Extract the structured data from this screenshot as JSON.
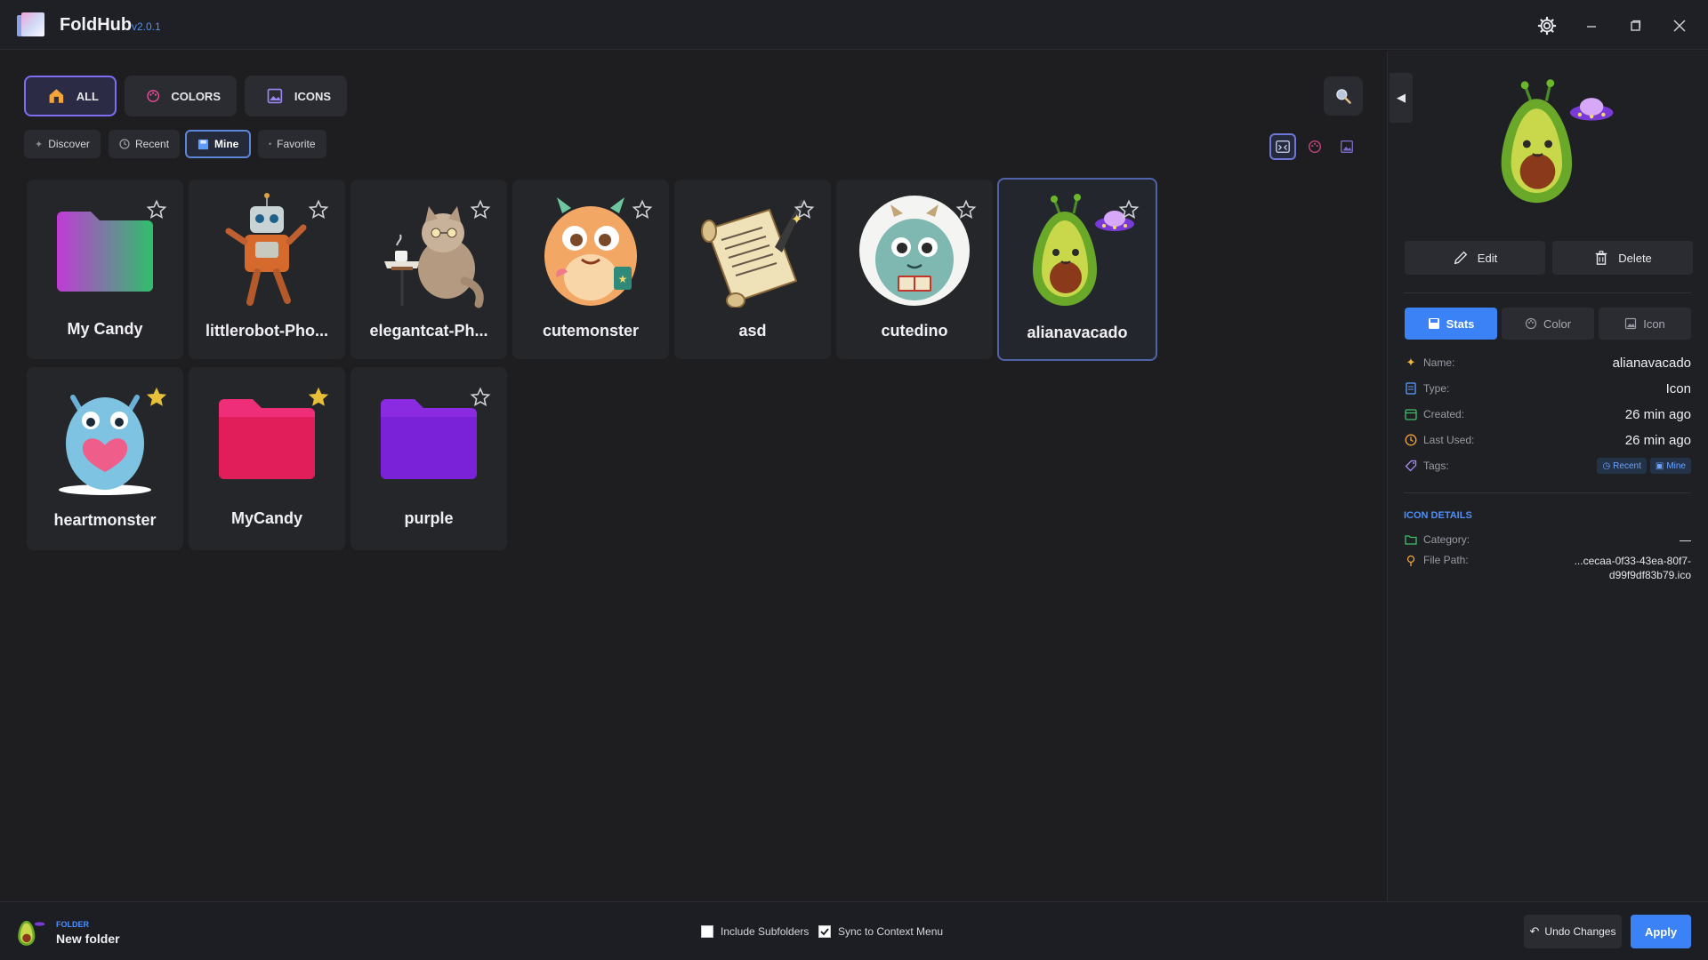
{
  "app": {
    "title": "FoldHub",
    "version": "v2.0.1",
    "icons": {
      "settings": "gear-icon",
      "minimize": "minimize-icon",
      "maximize": "maximize-icon",
      "close": "close-icon"
    }
  },
  "top_tabs": [
    {
      "label": "ALL",
      "icon": "home-icon",
      "active": true
    },
    {
      "label": "COLORS",
      "icon": "palette-icon",
      "active": false
    },
    {
      "label": "ICONS",
      "icon": "image-icon",
      "active": false
    }
  ],
  "sub_tabs": [
    {
      "label": "Discover",
      "icon": "sparkle-icon",
      "active": false
    },
    {
      "label": "Recent",
      "icon": "clock-icon",
      "active": false
    },
    {
      "label": "Mine",
      "icon": "save-icon",
      "active": true
    },
    {
      "label": "Favorite",
      "icon": "dot-icon",
      "active": false
    }
  ],
  "view_modes": [
    "all-view-icon",
    "color-view-icon",
    "icon-view-icon"
  ],
  "items": [
    {
      "name": "My Candy",
      "kind": "folder",
      "favorite": false,
      "gradient": [
        "#c13bd6",
        "#2fbf6a"
      ]
    },
    {
      "name": "littlerobot-Pho...",
      "kind": "icon",
      "favorite": false,
      "art": "robot"
    },
    {
      "name": "elegantcat-Ph...",
      "kind": "icon",
      "favorite": false,
      "art": "cat"
    },
    {
      "name": "cutemonster",
      "kind": "icon",
      "favorite": false,
      "art": "monster"
    },
    {
      "name": "asd",
      "kind": "icon",
      "favorite": false,
      "art": "scroll"
    },
    {
      "name": "cutedino",
      "kind": "icon",
      "favorite": false,
      "art": "dino"
    },
    {
      "name": "alianavacado",
      "kind": "icon",
      "favorite": false,
      "art": "avocado",
      "selected": true
    },
    {
      "name": "heartmonster",
      "kind": "icon",
      "favorite": true,
      "art": "heartmonster"
    },
    {
      "name": "MyCandy",
      "kind": "folder",
      "favorite": true,
      "gradient": [
        "#ee2e78",
        "#e21e5a"
      ]
    },
    {
      "name": "purple",
      "kind": "folder",
      "favorite": false,
      "gradient": [
        "#8a2be2",
        "#7a22d8"
      ]
    }
  ],
  "panel": {
    "edit_label": "Edit",
    "delete_label": "Delete",
    "tabs": [
      {
        "label": "Stats",
        "icon": "stats-icon",
        "active": true
      },
      {
        "label": "Color",
        "icon": "palette-icon",
        "active": false
      },
      {
        "label": "Icon",
        "icon": "image-icon",
        "active": false
      }
    ],
    "stats": {
      "name_label": "Name:",
      "name": "alianavacado",
      "type_label": "Type:",
      "type": "Icon",
      "created_label": "Created:",
      "created": "26 min ago",
      "last_used_label": "Last Used:",
      "last_used": "26 min ago",
      "tags_label": "Tags:",
      "tags": [
        "Recent",
        "Mine"
      ]
    },
    "details_title": "ICON DETAILS",
    "category_label": "Category:",
    "category": "—",
    "file_path_label": "File Path:",
    "file_path_1": "...cecaa-0f33-43ea-80f7-",
    "file_path_2": "d99f9df83b79.ico"
  },
  "bottom": {
    "folder_kicker": "FOLDER",
    "folder_name": "New folder",
    "include_subfolders": "Include Subfolders",
    "include_subfolders_checked": false,
    "sync_context": "Sync to Context Menu",
    "sync_context_checked": true,
    "undo_label": "Undo Changes",
    "apply_label": "Apply"
  },
  "colors": {
    "accent": "#3b82f6",
    "selection": "#7b6ff0",
    "star_gold": "#e7c03a"
  }
}
